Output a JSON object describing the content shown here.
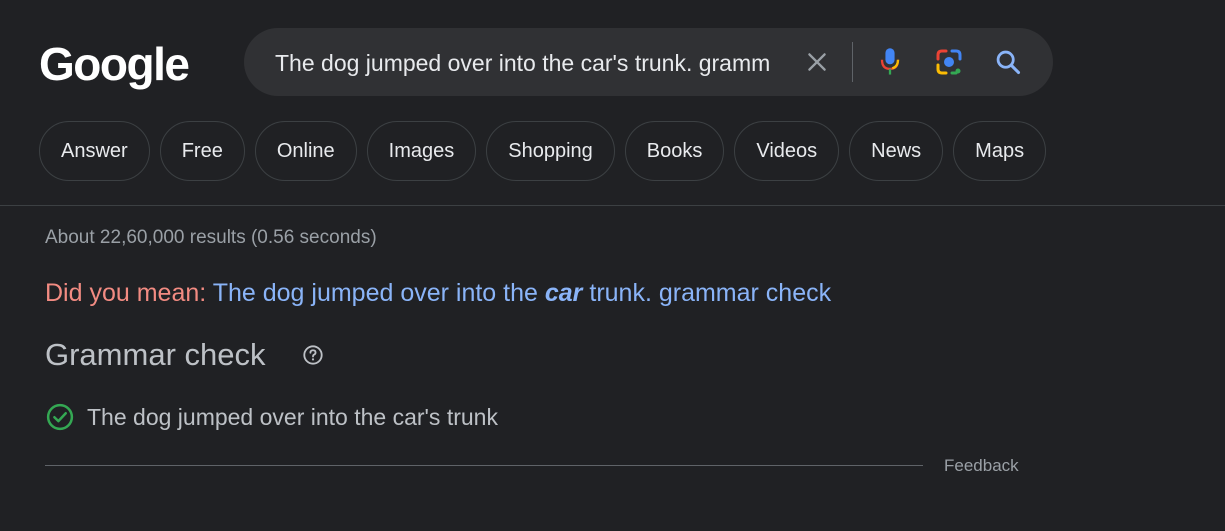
{
  "header": {
    "logo_text": "Google",
    "search": {
      "query": "The dog jumped over into the car's trunk. gramm"
    },
    "icons": [
      "clear-icon",
      "mic-icon",
      "lens-icon",
      "search-icon"
    ]
  },
  "chips": [
    "Answer",
    "Free",
    "Online",
    "Images",
    "Shopping",
    "Books",
    "Videos",
    "News",
    "Maps"
  ],
  "results": {
    "stats": "About 22,60,000 results (0.56 seconds)",
    "did_you_mean": {
      "label": "Did you mean:",
      "link_before": "The dog jumped over into the",
      "link_emphasis": "car",
      "link_after": "trunk. grammar check"
    },
    "grammar_check": {
      "title": "Grammar check",
      "result": "The dog jumped over into the car's trunk",
      "feedback": "Feedback"
    }
  },
  "colors": {
    "background": "#202124",
    "link": "#8ab4f8",
    "did_you_mean_label": "#f28b82",
    "check_green": "#34a853"
  }
}
